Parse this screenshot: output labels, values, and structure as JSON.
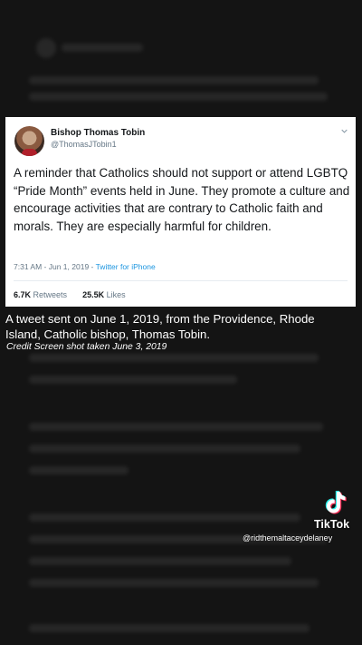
{
  "tweet": {
    "author_name": "Bishop Thomas Tobin",
    "author_handle": "@ThomasJTobin1",
    "text": "A reminder that Catholics should not support or attend LGBTQ “Pride Month” events held in June. They promote a culture and encourage activities that are contrary to Catholic faith and morals. They are especially harmful for children.",
    "time_date": "7:31 AM - Jun 1, 2019 - ",
    "via": "Twitter for iPhone",
    "retweets_count": "6.7K",
    "retweets_label": "Retweets",
    "likes_count": "25.5K",
    "likes_label": "Likes"
  },
  "caption": {
    "text": "A tweet sent on June 1, 2019, from the Providence, Rhode Island, Catholic bishop, Thomas Tobin.",
    "credit": "Credit Screen shot taken June 3, 2019"
  },
  "overlay": {
    "brand": "TikTok",
    "username": "@ridthemaltaceydelaney",
    "logo_icon": "tiktok-logo-icon"
  },
  "colors": {
    "background": "#141414",
    "card": "#ffffff",
    "link": "#1b95e0",
    "muted": "#657786"
  }
}
